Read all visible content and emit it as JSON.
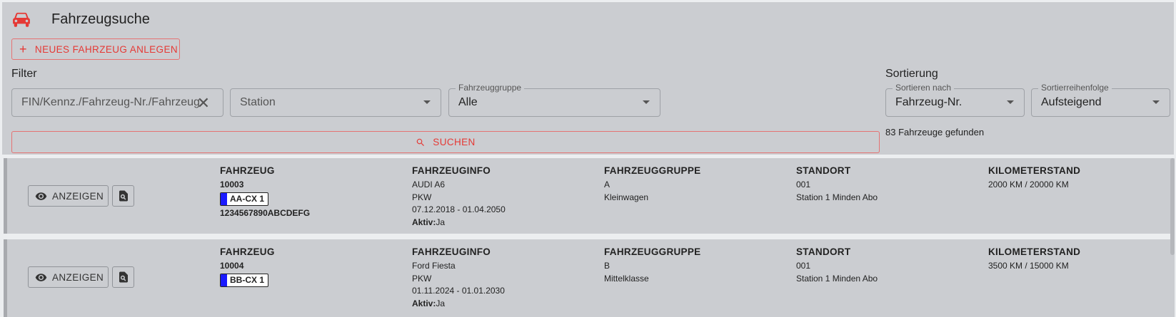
{
  "header": {
    "title": "Fahrzeugsuche",
    "icon": "car-icon",
    "accent": "#e53935"
  },
  "actions": {
    "new_vehicle_label": "NEUES FAHRZEUG ANLEGEN",
    "search_label": "SUCHEN"
  },
  "filter": {
    "section_label": "Filter",
    "search_placeholder": "FIN/Kennz./Fahrzeug-Nr./Fahrzeug",
    "station_placeholder": "Station",
    "group_label": "Fahrzeuggruppe",
    "group_value": "Alle"
  },
  "sort": {
    "section_label": "Sortierung",
    "sort_by_label": "Sortieren nach",
    "sort_by_value": "Fahrzeug-Nr.",
    "order_label": "Sortierreihenfolge",
    "order_value": "Aufsteigend"
  },
  "result_count": "83 Fahrzeuge gefunden",
  "columns": {
    "vehicle": "FAHRZEUG",
    "info": "FAHRZEUGINFO",
    "group": "FAHRZEUGGRUPPE",
    "location": "STANDORT",
    "mileage": "KILOMETERSTAND"
  },
  "row_actions": {
    "show_label": "ANZEIGEN"
  },
  "vehicles": [
    {
      "number": "10003",
      "plate": "AA-CX 1",
      "vin": "1234567890ABCDEFG",
      "model": "AUDI A6",
      "type": "PKW",
      "period": "07.12.2018 - 01.04.2050",
      "active_label": "Aktiv:",
      "active_value": "Ja",
      "group_code": "A",
      "group_name": "Kleinwagen",
      "station_code": "001",
      "station_name": "Station 1 Minden Abo",
      "mileage": "2000 KM / 20000 KM"
    },
    {
      "number": "10004",
      "plate": "BB-CX 1",
      "vin": "",
      "model": "Ford Fiesta",
      "type": "PKW",
      "period": "01.11.2024 - 01.01.2030",
      "active_label": "Aktiv:",
      "active_value": "Ja",
      "group_code": "B",
      "group_name": "Mittelklasse",
      "station_code": "001",
      "station_name": "Station 1 Minden Abo",
      "mileage": "3500 KM / 15000 KM"
    }
  ]
}
